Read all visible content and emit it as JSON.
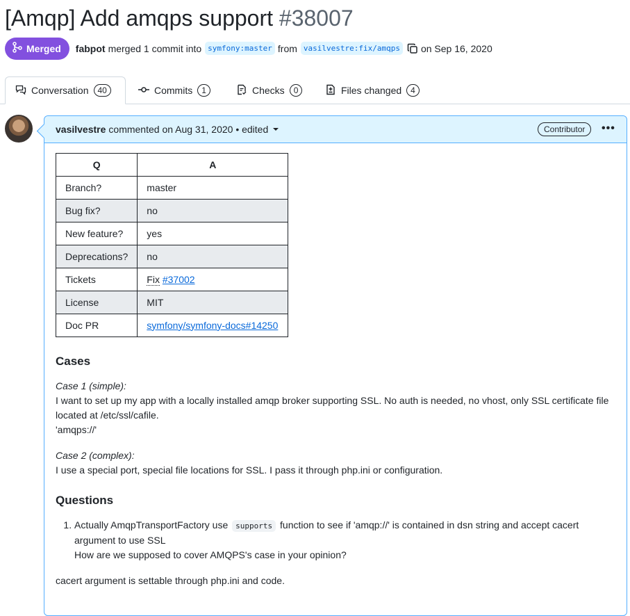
{
  "pr": {
    "title": "[Amqp] Add amqps support",
    "number": "#38007",
    "status": "Merged",
    "merger": "fabpot",
    "merged_text": "merged 1 commit into",
    "base_branch": "symfony:master",
    "from_text": "from",
    "head_branch": "vasilvestre:fix/amqps",
    "date_text": "on Sep 16, 2020"
  },
  "tabs": [
    {
      "label": "Conversation",
      "count": "40",
      "icon": "comment-discussion-icon"
    },
    {
      "label": "Commits",
      "count": "1",
      "icon": "git-commit-icon"
    },
    {
      "label": "Checks",
      "count": "0",
      "icon": "checklist-icon"
    },
    {
      "label": "Files changed",
      "count": "4",
      "icon": "file-diff-icon"
    }
  ],
  "comment": {
    "author": "vasilvestre",
    "action": "commented on Aug 31, 2020 • edited",
    "role": "Contributor",
    "table": {
      "headers": [
        "Q",
        "A"
      ],
      "rows": [
        {
          "q": "Branch?",
          "a": "master"
        },
        {
          "q": "Bug fix?",
          "a": "no"
        },
        {
          "q": "New feature?",
          "a": "yes"
        },
        {
          "q": "Deprecations?",
          "a": "no"
        },
        {
          "q": "Tickets",
          "a_prefix": "Fix",
          "a": "#37002"
        },
        {
          "q": "License",
          "a": "MIT"
        },
        {
          "q": "Doc PR",
          "a": "symfony/symfony-docs#14250"
        }
      ]
    },
    "cases_heading": "Cases",
    "case1_title": "Case 1 (simple):",
    "case1_text": "I want to set up my app with a locally installed amqp broker supporting SSL. No auth is needed, no vhost, only SSL certificate file located at /etc/ssl/cafile.",
    "case1_dsn": "'amqps://'",
    "case2_title": "Case 2 (complex):",
    "case2_text": "I use a special port, special file locations for SSL. I pass it through php.ini or configuration.",
    "questions_heading": "Questions",
    "q1_before": "Actually AmqpTransportFactory use",
    "q1_code": "supports",
    "q1_after": "function to see if 'amqp://' is contained in dsn string and accept cacert argument to use SSL",
    "q1_line2": "How are we supposed to cover AMQPS's case in your opinion?",
    "closing": "cacert argument is settable through php.ini and code."
  }
}
